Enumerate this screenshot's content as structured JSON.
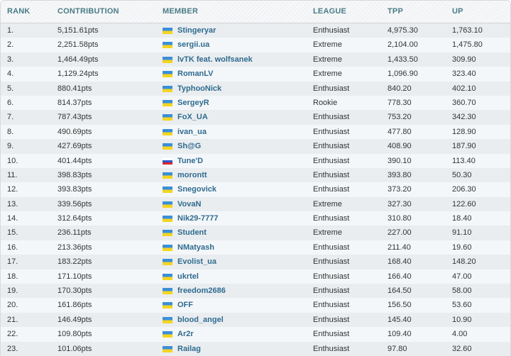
{
  "columns": [
    "RANK",
    "CONTRIBUTION",
    "MEMBER",
    "LEAGUE",
    "TPP",
    "UP"
  ],
  "flag_colors": {
    "ua": [
      "#3a8fd9",
      "#f5d520"
    ],
    "ru": [
      "#ffffff",
      "#2f56c8",
      "#d9282f"
    ]
  },
  "rows": [
    {
      "rank": "1.",
      "contribution": "5,151.61pts",
      "flag": "ua",
      "member": "Stingeryar",
      "league": "Enthusiast",
      "tpp": "4,975.30",
      "up": "1,763.10"
    },
    {
      "rank": "2.",
      "contribution": "2,251.58pts",
      "flag": "ua",
      "member": "sergii.ua",
      "league": "Extreme",
      "tpp": "2,104.00",
      "up": "1,475.80"
    },
    {
      "rank": "3.",
      "contribution": "1,464.49pts",
      "flag": "ua",
      "member": "lvTK feat. wolfsanek",
      "league": "Extreme",
      "tpp": "1,433.50",
      "up": "309.90"
    },
    {
      "rank": "4.",
      "contribution": "1,129.24pts",
      "flag": "ua",
      "member": "RomanLV",
      "league": "Extreme",
      "tpp": "1,096.90",
      "up": "323.40"
    },
    {
      "rank": "5.",
      "contribution": "880.41pts",
      "flag": "ua",
      "member": "TyphooNick",
      "league": "Enthusiast",
      "tpp": "840.20",
      "up": "402.10"
    },
    {
      "rank": "6.",
      "contribution": "814.37pts",
      "flag": "ua",
      "member": "SergeyR",
      "league": "Rookie",
      "tpp": "778.30",
      "up": "360.70"
    },
    {
      "rank": "7.",
      "contribution": "787.43pts",
      "flag": "ua",
      "member": "FoX_UA",
      "league": "Enthusiast",
      "tpp": "753.20",
      "up": "342.30"
    },
    {
      "rank": "8.",
      "contribution": "490.69pts",
      "flag": "ua",
      "member": "ivan_ua",
      "league": "Enthusiast",
      "tpp": "477.80",
      "up": "128.90"
    },
    {
      "rank": "9.",
      "contribution": "427.69pts",
      "flag": "ua",
      "member": "Sh@G",
      "league": "Enthusiast",
      "tpp": "408.90",
      "up": "187.90"
    },
    {
      "rank": "10.",
      "contribution": "401.44pts",
      "flag": "ru",
      "member": "Tune'D",
      "league": "Enthusiast",
      "tpp": "390.10",
      "up": "113.40"
    },
    {
      "rank": "11.",
      "contribution": "398.83pts",
      "flag": "ua",
      "member": "morontt",
      "league": "Enthusiast",
      "tpp": "393.80",
      "up": "50.30"
    },
    {
      "rank": "12.",
      "contribution": "393.83pts",
      "flag": "ua",
      "member": "Snegovick",
      "league": "Enthusiast",
      "tpp": "373.20",
      "up": "206.30"
    },
    {
      "rank": "13.",
      "contribution": "339.56pts",
      "flag": "ua",
      "member": "VovaN",
      "league": "Extreme",
      "tpp": "327.30",
      "up": "122.60"
    },
    {
      "rank": "14.",
      "contribution": "312.64pts",
      "flag": "ua",
      "member": "Nik29-7777",
      "league": "Enthusiast",
      "tpp": "310.80",
      "up": "18.40"
    },
    {
      "rank": "15.",
      "contribution": "236.11pts",
      "flag": "ua",
      "member": "Student",
      "league": "Extreme",
      "tpp": "227.00",
      "up": "91.10"
    },
    {
      "rank": "16.",
      "contribution": "213.36pts",
      "flag": "ua",
      "member": "NMatyash",
      "league": "Enthusiast",
      "tpp": "211.40",
      "up": "19.60"
    },
    {
      "rank": "17.",
      "contribution": "183.22pts",
      "flag": "ua",
      "member": "Evolist_ua",
      "league": "Enthusiast",
      "tpp": "168.40",
      "up": "148.20"
    },
    {
      "rank": "18.",
      "contribution": "171.10pts",
      "flag": "ua",
      "member": "ukrtel",
      "league": "Enthusiast",
      "tpp": "166.40",
      "up": "47.00"
    },
    {
      "rank": "19.",
      "contribution": "170.30pts",
      "flag": "ua",
      "member": "freedom2686",
      "league": "Enthusiast",
      "tpp": "164.50",
      "up": "58.00"
    },
    {
      "rank": "20.",
      "contribution": "161.86pts",
      "flag": "ua",
      "member": "OFF",
      "league": "Enthusiast",
      "tpp": "156.50",
      "up": "53.60"
    },
    {
      "rank": "21.",
      "contribution": "146.49pts",
      "flag": "ua",
      "member": "blood_angel",
      "league": "Enthusiast",
      "tpp": "145.40",
      "up": "10.90"
    },
    {
      "rank": "22.",
      "contribution": "109.80pts",
      "flag": "ua",
      "member": "Ar2r",
      "league": "Enthusiast",
      "tpp": "109.40",
      "up": "4.00"
    },
    {
      "rank": "23.",
      "contribution": "101.06pts",
      "flag": "ua",
      "member": "Railag",
      "league": "Enthusiast",
      "tpp": "97.80",
      "up": "32.60"
    }
  ]
}
